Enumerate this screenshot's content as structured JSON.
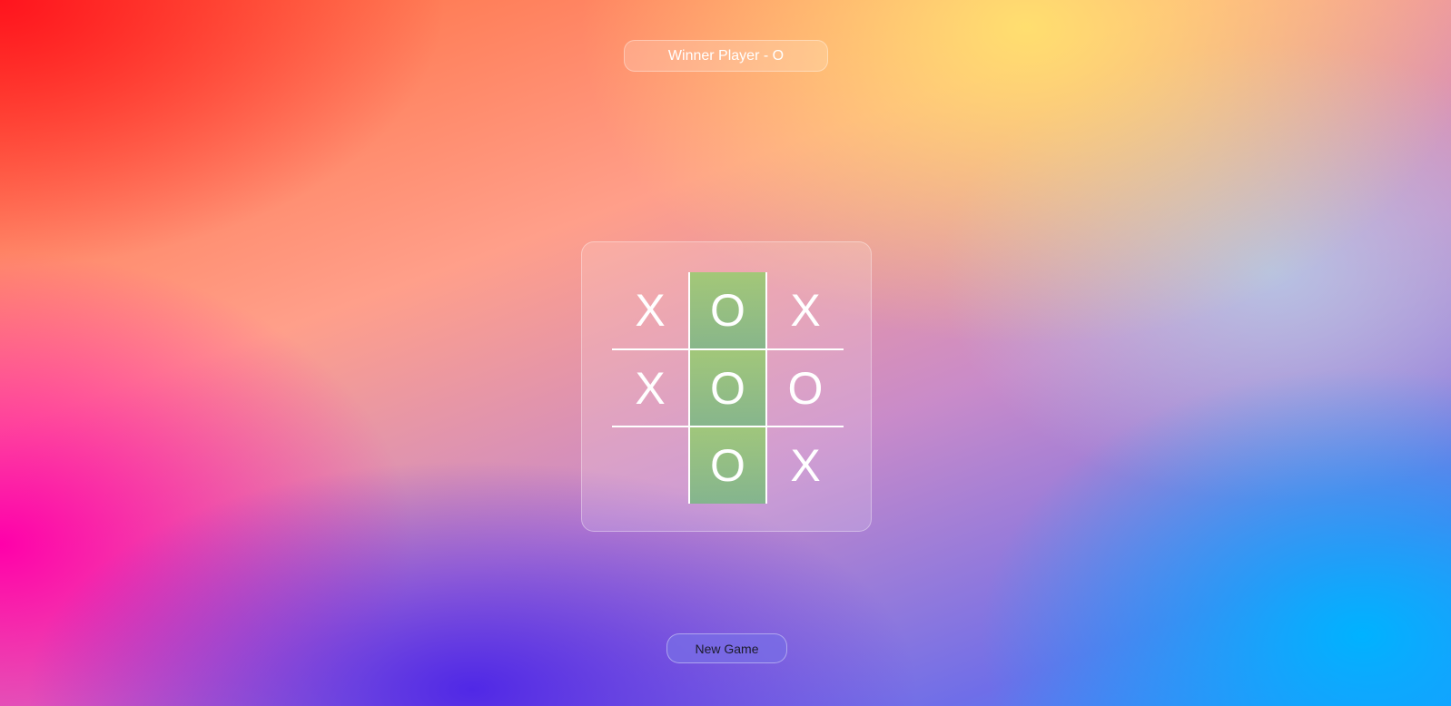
{
  "status": {
    "text": "Winner Player - O"
  },
  "board": {
    "cells": [
      "X",
      "O",
      "X",
      "X",
      "O",
      "O",
      "",
      "O",
      "X"
    ],
    "winning_cells": [
      1,
      4,
      7
    ],
    "win_highlight_color": "#9ccd78"
  },
  "controls": {
    "new_game_label": "New Game"
  }
}
